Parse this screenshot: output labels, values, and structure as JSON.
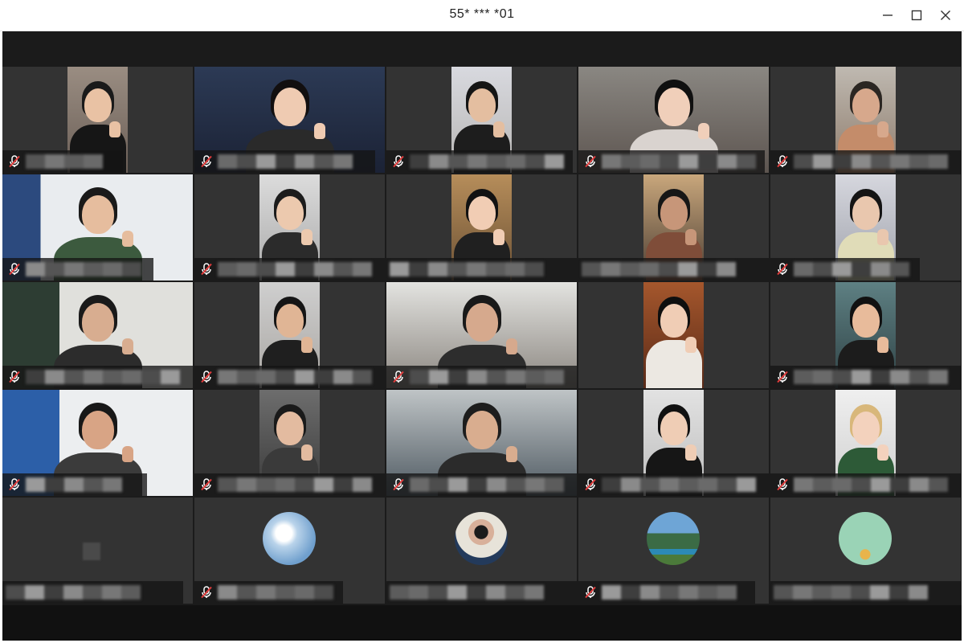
{
  "window": {
    "title": "55* *** *01"
  },
  "colors": {
    "stage": "#1b1b1b",
    "tile": "#333333",
    "muted_icon": "#e33d3d"
  },
  "icons": {
    "minimize": "minimize-icon",
    "maximize": "maximize-icon",
    "close": "close-icon",
    "muted_mic": "muted-microphone-icon"
  },
  "grid": {
    "rows": 5,
    "columns": 5,
    "participants": [
      {
        "row": 1,
        "col": 1,
        "camera": "portrait",
        "muted": true
      },
      {
        "row": 1,
        "col": 2,
        "camera": "full",
        "muted": true
      },
      {
        "row": 1,
        "col": 3,
        "camera": "portrait",
        "muted": true
      },
      {
        "row": 1,
        "col": 4,
        "camera": "full",
        "muted": true
      },
      {
        "row": 1,
        "col": 5,
        "camera": "portrait",
        "muted": true
      },
      {
        "row": 2,
        "col": 1,
        "camera": "full",
        "muted": true
      },
      {
        "row": 2,
        "col": 2,
        "camera": "portrait",
        "muted": true
      },
      {
        "row": 2,
        "col": 3,
        "camera": "portrait",
        "muted": false
      },
      {
        "row": 2,
        "col": 4,
        "camera": "portrait",
        "muted": false
      },
      {
        "row": 2,
        "col": 5,
        "camera": "portrait",
        "muted": true
      },
      {
        "row": 3,
        "col": 1,
        "camera": "full",
        "muted": true
      },
      {
        "row": 3,
        "col": 2,
        "camera": "portrait",
        "muted": true
      },
      {
        "row": 3,
        "col": 3,
        "camera": "full",
        "muted": true
      },
      {
        "row": 3,
        "col": 4,
        "camera": "portrait",
        "muted": false
      },
      {
        "row": 3,
        "col": 5,
        "camera": "portrait",
        "muted": true
      },
      {
        "row": 4,
        "col": 1,
        "camera": "full",
        "muted": true
      },
      {
        "row": 4,
        "col": 2,
        "camera": "portrait",
        "muted": true
      },
      {
        "row": 4,
        "col": 3,
        "camera": "full",
        "muted": true
      },
      {
        "row": 4,
        "col": 4,
        "camera": "portrait",
        "muted": true
      },
      {
        "row": 4,
        "col": 5,
        "camera": "portrait",
        "muted": true
      },
      {
        "row": 5,
        "col": 1,
        "camera": "off",
        "muted": false
      },
      {
        "row": 5,
        "col": 2,
        "camera": "off",
        "muted": true,
        "avatar": "sky-clouds-avatar"
      },
      {
        "row": 5,
        "col": 3,
        "camera": "off",
        "muted": false,
        "avatar": "person-photo-avatar"
      },
      {
        "row": 5,
        "col": 4,
        "camera": "off",
        "muted": true,
        "avatar": "landscape-avatar"
      },
      {
        "row": 5,
        "col": 5,
        "camera": "off",
        "muted": false,
        "avatar": "illustration-avatar"
      }
    ]
  }
}
